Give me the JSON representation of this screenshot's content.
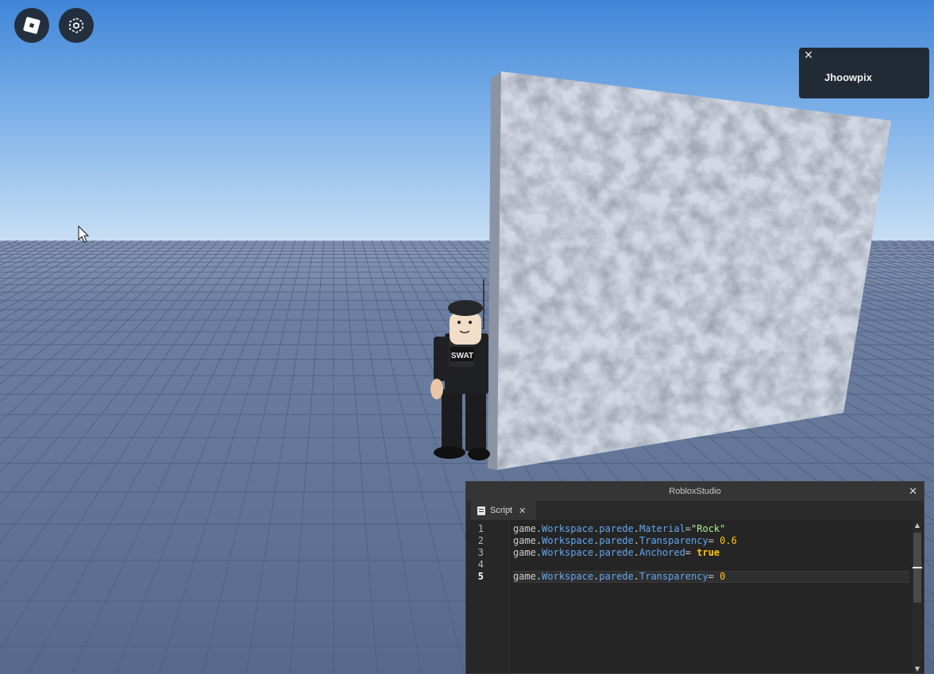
{
  "app": {
    "roblox_menu_icon": "roblox-logo-icon",
    "cube_icon": "cube-select-icon"
  },
  "notification": {
    "close_label": "✕",
    "player_name": "Jhoowpix"
  },
  "studio_window": {
    "title": "RobloxStudio",
    "close_label": "✕",
    "tab": {
      "label": "Script",
      "close_label": "✕"
    },
    "current_line": 5,
    "code_lines": [
      {
        "n": "1",
        "text": "game.Workspace.parede.Material=\"Rock\""
      },
      {
        "n": "2",
        "text": "game.Workspace.parede.Transparency= 0.6"
      },
      {
        "n": "3",
        "text": "game.Workspace.parede.Anchored= true"
      },
      {
        "n": "4",
        "text": ""
      },
      {
        "n": "5",
        "text": "game.Workspace.parede.Transparency= 0"
      }
    ]
  },
  "scene": {
    "character_badge": "SWAT",
    "sky_color_top": "#3f86d8",
    "sky_color_horizon": "#c9dff4",
    "floor_color": "#5b6f92",
    "wall_material": "Rock"
  }
}
